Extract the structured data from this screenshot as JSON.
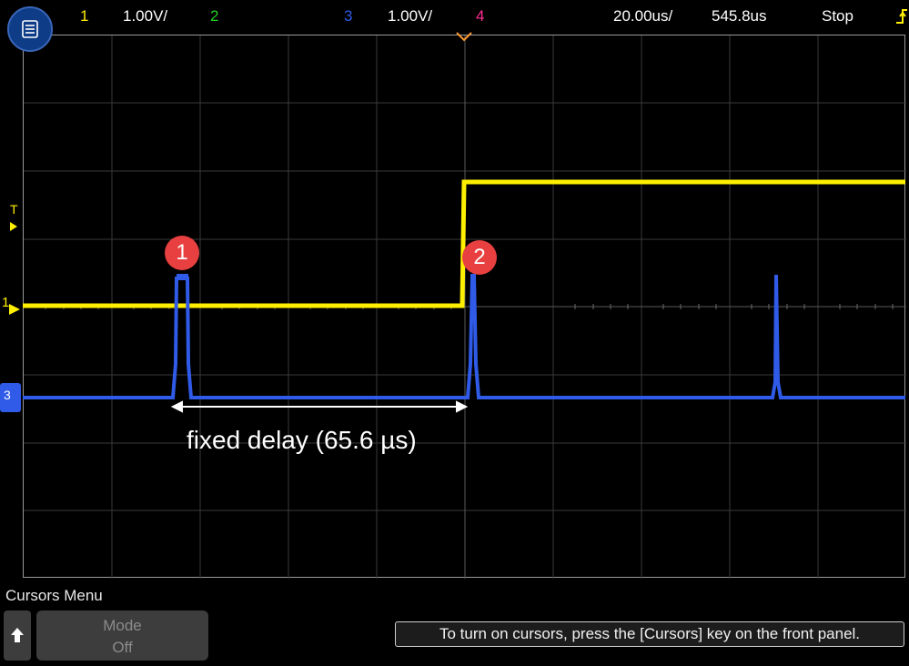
{
  "topbar": {
    "ch1_label": "1",
    "ch1_scale": "1.00V/",
    "ch2_label": "2",
    "ch3_label": "3",
    "ch3_scale": "1.00V/",
    "ch4_label": "4",
    "timebase": "20.00us/",
    "delay": "545.8us",
    "run_state": "Stop",
    "trigger_icon": "trigger-edge-icon"
  },
  "colors": {
    "ch1": "#ffef00",
    "ch2": "#22d422",
    "ch3": "#2f5be8",
    "ch4": "#ff2e93",
    "marker": "#e84040"
  },
  "markers": {
    "m1": "1",
    "m2": "2"
  },
  "annotation": "fixed delay (65.6 µs)",
  "channel_indicators": {
    "trigger": "T",
    "ch1": "1",
    "ch3": "3"
  },
  "softkeys": {
    "menu_title": "Cursors Menu",
    "mode_label": "Mode",
    "mode_value": "Off"
  },
  "status_message": "To turn on cursors, press the [Cursors] key on the front panel."
}
